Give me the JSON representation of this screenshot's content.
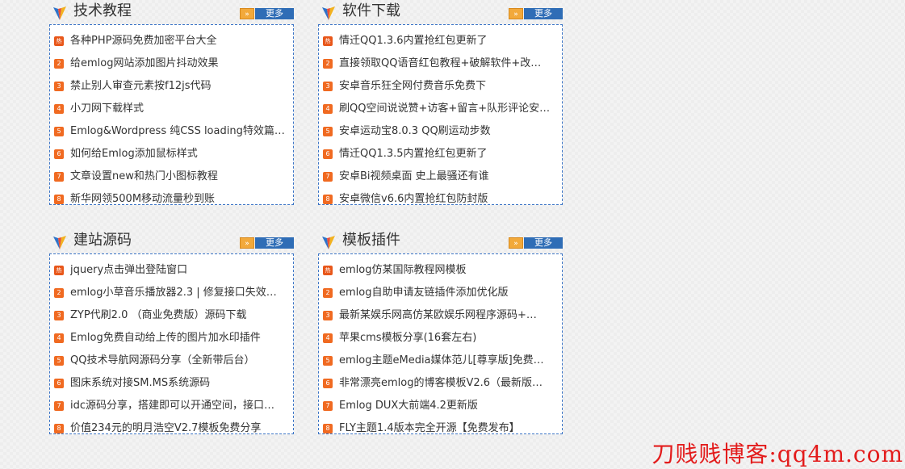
{
  "more_label": "更多",
  "more_arrow": "»",
  "hot_badge": "热",
  "accent_color": "#3c75c6",
  "rank_color": "#f06a21",
  "panels": [
    {
      "title": "技术教程",
      "items": [
        "各种PHP源码免费加密平台大全",
        "给emlog网站添加图片抖动效果",
        "禁止别人审查元素按f12js代码",
        "小刀网下载样式",
        "Emlog&Wordpress 纯CSS loading特效篇…",
        "如何给Emlog添加鼠标样式",
        "文章设置new和热门小图标教程",
        "新华网领500M移动流量秒到账"
      ]
    },
    {
      "title": "软件下载",
      "items": [
        "情迁QQ1.3.6内置抢红包更新了",
        "直接领取QQ语音红包教程+破解软件+改…",
        "安卓音乐狂全网付费音乐免费下",
        "刷QQ空间说说赞+访客+留言+队形评论安…",
        "安卓运动宝8.0.3 QQ刷运动步数",
        "情迁QQ1.3.5内置抢红包更新了",
        "安卓Bi视频桌面 史上最骚还有谁",
        "安卓微信v6.6内置抢红包防封版"
      ]
    },
    {
      "title": "建站源码",
      "items": [
        "jquery点击弹出登陆窗口",
        "emlog小草音乐播放器2.3 | 修复接口失效…",
        "ZYP代刷2.0 （商业免费版）源码下载",
        "Emlog免费自动给上传的图片加水印插件",
        "QQ技术导航网源码分享（全新带后台）",
        "图床系统对接SM.MS系统源码",
        "idc源码分享，搭建即可以开通空间，接口…",
        "价值234元的明月浩空V2.7模板免费分享"
      ]
    },
    {
      "title": "模板插件",
      "items": [
        "emlog仿某国际教程网模板",
        "emlog自助申请友链插件添加优化版",
        "最新某娱乐网高仿某欧娱乐网程序源码+…",
        "苹果cms模板分享(16套左右)",
        "emlog主题eMedia媒体范儿[尊享版]免费…",
        "非常漂亮emlog的博客模板V2.6（最新版…",
        "Emlog DUX大前端4.2更新版",
        "FLY主题1.4版本完全开源【免费发布】"
      ]
    }
  ],
  "watermark": "刀贱贱博客:qq4m.com"
}
